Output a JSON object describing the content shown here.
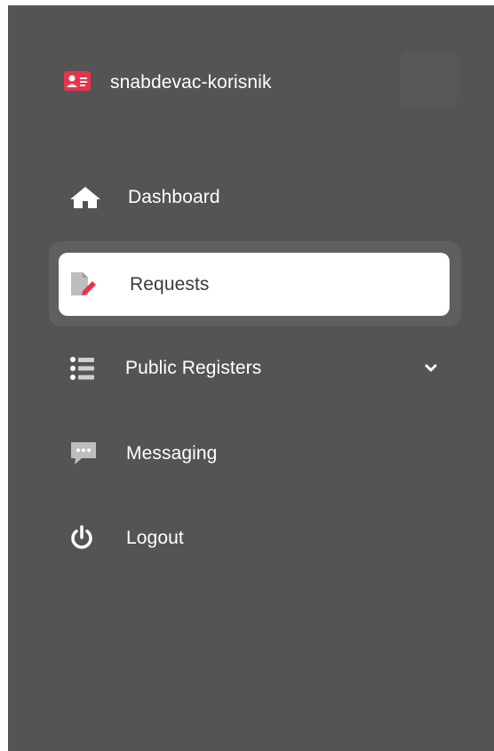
{
  "user": {
    "name": "snabdevac-korisnik",
    "icon": "id-card-icon"
  },
  "nav": {
    "items": [
      {
        "label": "Dashboard",
        "icon": "home-icon"
      },
      {
        "label": "Requests",
        "icon": "document-edit-icon",
        "active": true
      },
      {
        "label": "Public Registers",
        "icon": "list-icon",
        "expandable": true
      },
      {
        "label": "Messaging",
        "icon": "chat-icon"
      },
      {
        "label": "Logout",
        "icon": "power-icon"
      }
    ]
  },
  "colors": {
    "sidebar_bg": "#545454",
    "accent": "#e8344a",
    "active_bg": "#ffffff"
  }
}
